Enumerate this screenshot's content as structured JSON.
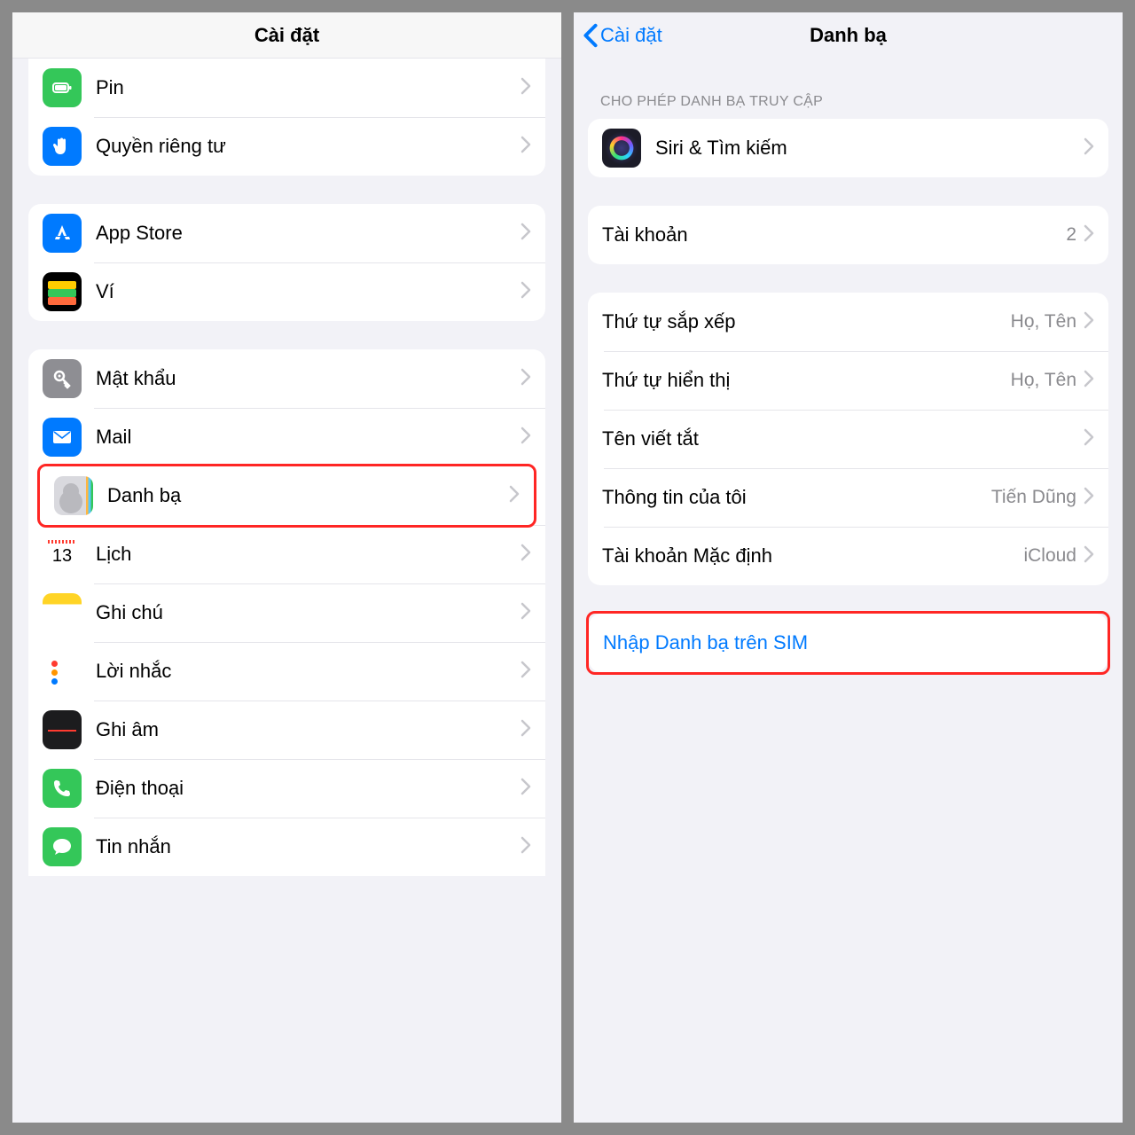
{
  "left": {
    "title": "Cài đặt",
    "group1": [
      {
        "label": "Pin",
        "icon": "battery-icon"
      },
      {
        "label": "Quyền riêng tư",
        "icon": "privacy-hand-icon"
      }
    ],
    "group2": [
      {
        "label": "App Store",
        "icon": "appstore-icon"
      },
      {
        "label": "Ví",
        "icon": "wallet-icon"
      }
    ],
    "group3": [
      {
        "label": "Mật khẩu",
        "icon": "key-icon"
      },
      {
        "label": "Mail",
        "icon": "mail-icon"
      },
      {
        "label": "Danh bạ",
        "icon": "contacts-icon",
        "highlight": true
      },
      {
        "label": "Lịch",
        "icon": "calendar-icon"
      },
      {
        "label": "Ghi chú",
        "icon": "notes-icon"
      },
      {
        "label": "Lời nhắc",
        "icon": "reminders-icon"
      },
      {
        "label": "Ghi âm",
        "icon": "voicememo-icon"
      },
      {
        "label": "Điện thoại",
        "icon": "phone-icon"
      },
      {
        "label": "Tin nhắn",
        "icon": "messages-icon"
      }
    ]
  },
  "right": {
    "back": "Cài đặt",
    "title": "Danh bạ",
    "section_allow": "CHO PHÉP DANH BẠ TRUY CẬP",
    "siri_label": "Siri & Tìm kiếm",
    "accounts_label": "Tài khoản",
    "accounts_value": "2",
    "sort_label": "Thứ tự sắp xếp",
    "sort_value": "Họ, Tên",
    "display_label": "Thứ tự hiển thị",
    "display_value": "Họ, Tên",
    "shortname_label": "Tên viết tắt",
    "myinfo_label": "Thông tin của tôi",
    "myinfo_value": "Tiến Dũng",
    "default_label": "Tài khoản Mặc định",
    "default_value": "iCloud",
    "import_label": "Nhập Danh bạ trên SIM"
  }
}
